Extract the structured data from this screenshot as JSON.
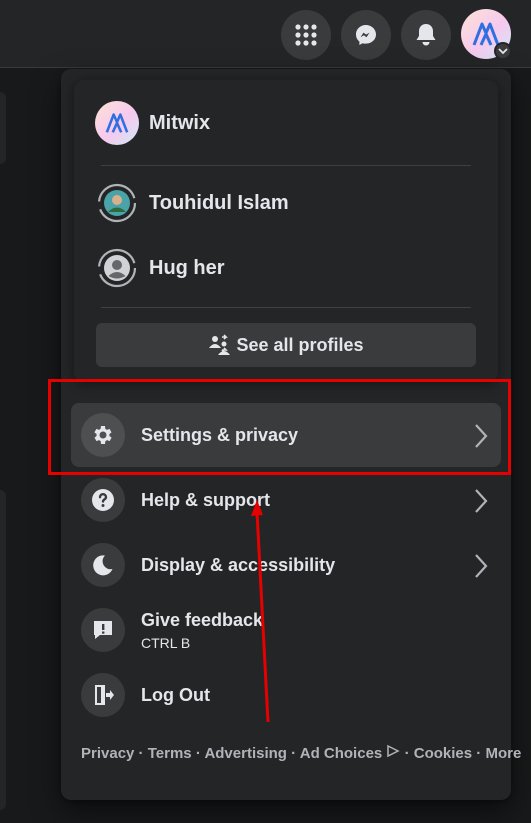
{
  "topbar": {
    "icons": [
      "menu-grid-icon",
      "messenger-icon",
      "bell-icon",
      "account-avatar"
    ]
  },
  "menu": {
    "current_profile": {
      "name": "Mitwix"
    },
    "other_profiles": [
      {
        "name": "Touhidul Islam"
      },
      {
        "name": "Hug her"
      }
    ],
    "see_all_label": "See all profiles",
    "items": [
      {
        "label": "Settings & privacy",
        "icon": "gear-icon",
        "has_chevron": true,
        "active": true
      },
      {
        "label": "Help & support",
        "icon": "help-icon",
        "has_chevron": true
      },
      {
        "label": "Display & accessibility",
        "icon": "moon-icon",
        "has_chevron": true
      },
      {
        "label": "Give feedback",
        "sublabel": "CTRL B",
        "icon": "feedback-icon"
      },
      {
        "label": "Log Out",
        "icon": "logout-icon"
      }
    ],
    "footer_links": [
      "Privacy",
      "Terms",
      "Advertising",
      "Ad Choices",
      "Cookies",
      "More"
    ],
    "footer_separator": " · "
  },
  "colors": {
    "annotation_red": "#e60000",
    "menu_bg": "#242526",
    "item_hover": "#3a3b3c",
    "brand_blue": "#1877f2"
  }
}
